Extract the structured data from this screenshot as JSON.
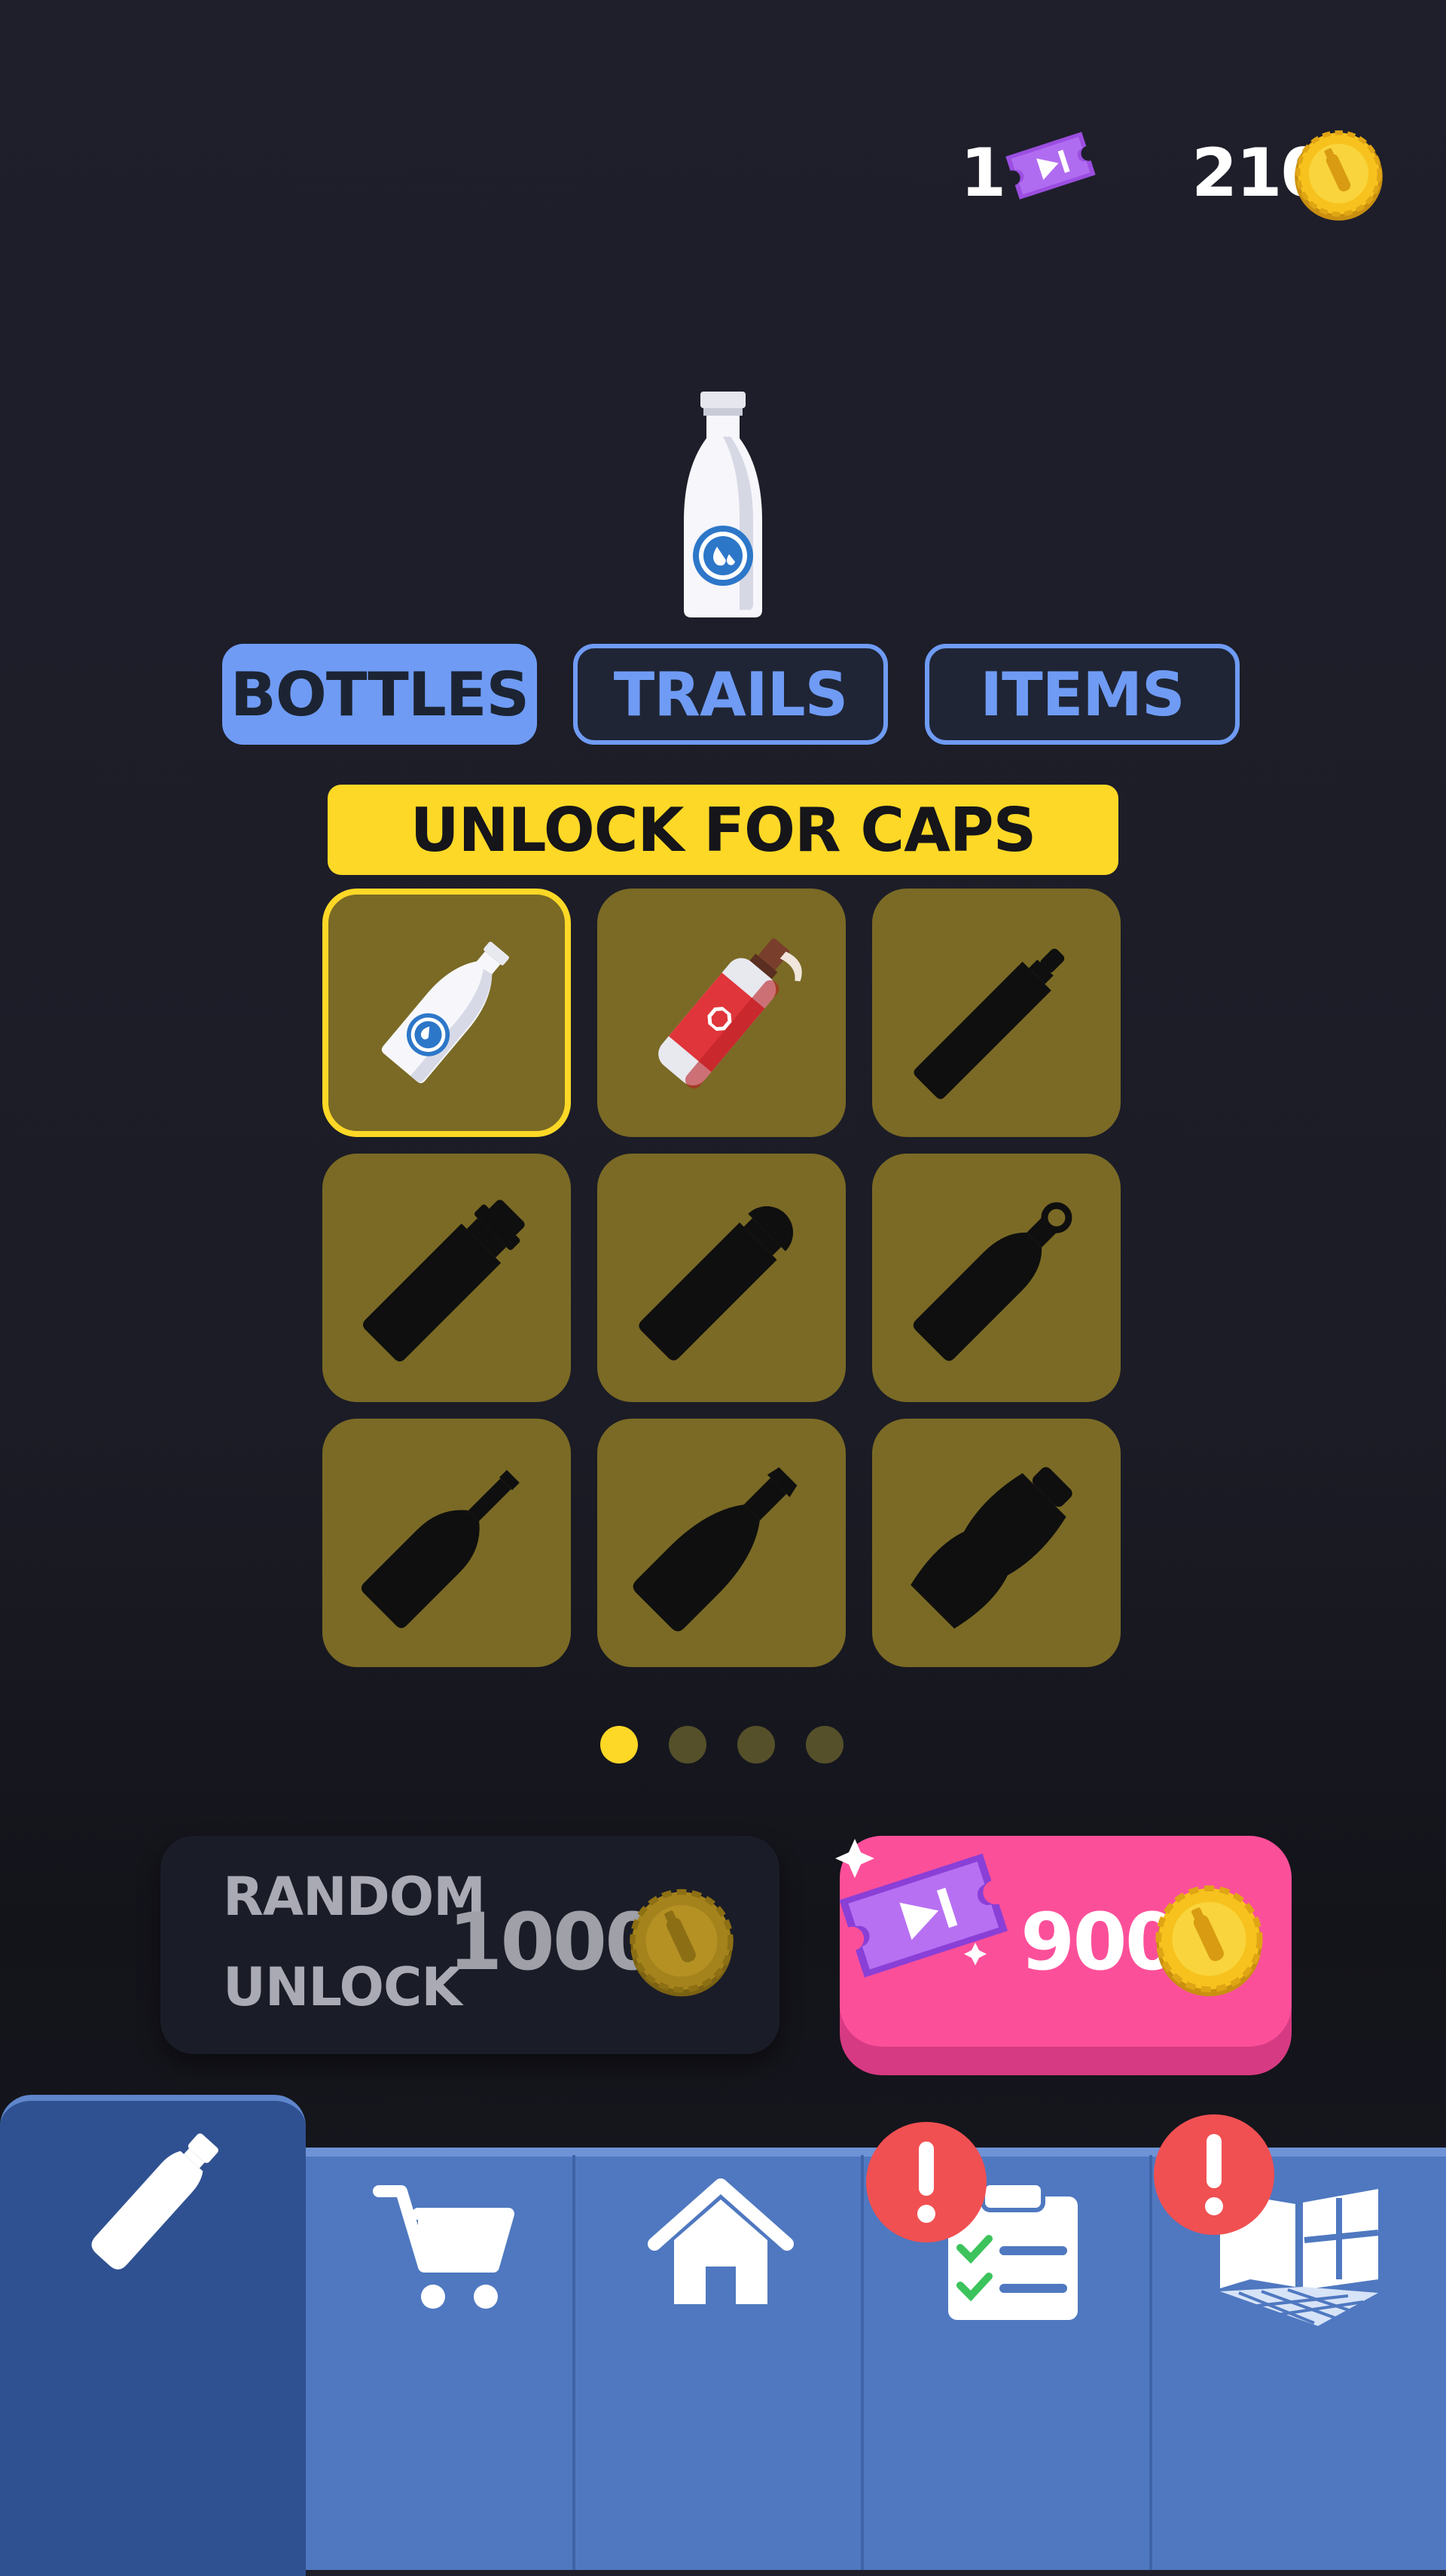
{
  "currency": {
    "tickets": "1",
    "caps": "210"
  },
  "tabs": [
    {
      "label": "BOTTLES",
      "active": true
    },
    {
      "label": "TRAILS",
      "active": false
    },
    {
      "label": "ITEMS",
      "active": false
    }
  ],
  "banner": "UNLOCK FOR CAPS",
  "grid": [
    {
      "item": "milk-bottle",
      "unlocked": true,
      "selected": true
    },
    {
      "item": "red-spray-bottle",
      "unlocked": true,
      "selected": false
    },
    {
      "item": "locked-bottle-1",
      "unlocked": false
    },
    {
      "item": "locked-bottle-2",
      "unlocked": false
    },
    {
      "item": "locked-bottle-3",
      "unlocked": false
    },
    {
      "item": "locked-bottle-4",
      "unlocked": false
    },
    {
      "item": "locked-bottle-5",
      "unlocked": false
    },
    {
      "item": "locked-bottle-6",
      "unlocked": false
    },
    {
      "item": "locked-bottle-7",
      "unlocked": false
    }
  ],
  "pagination": {
    "pages": 4,
    "current": 1
  },
  "random_unlock": {
    "line1": "RANDOM",
    "line2": "UNLOCK",
    "price": "1000"
  },
  "ad_unlock": {
    "price": "900"
  },
  "nav": {
    "items": [
      "bottle-icon",
      "cart-icon",
      "home-icon",
      "checklist-icon",
      "stage-icon"
    ],
    "active": "bottle-icon",
    "alerts": [
      "checklist-icon",
      "stage-icon"
    ]
  },
  "colors": {
    "accent_blue": "#6f9bf4",
    "banner_yellow": "#fdd826",
    "cell_gold": "#7a6a25",
    "pink": "#fc4f9a",
    "nav_blue": "#4f78c0",
    "alert_red": "#f05052"
  }
}
